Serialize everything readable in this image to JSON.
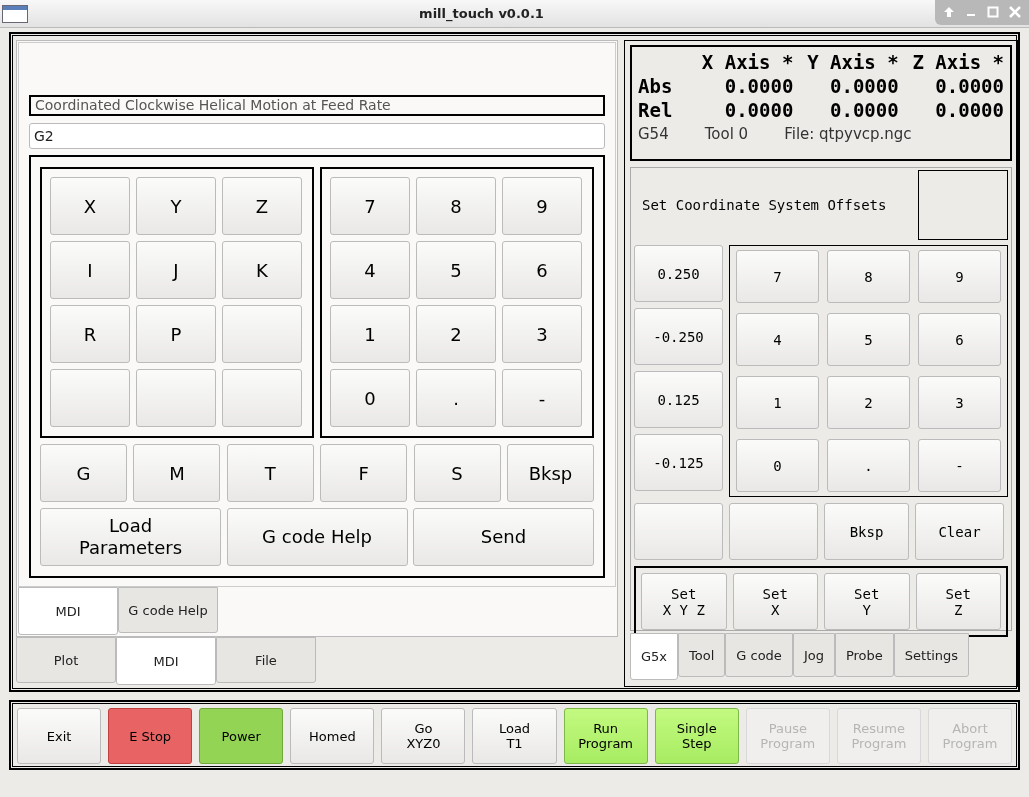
{
  "window": {
    "title": "mill_touch v0.0.1"
  },
  "mdi": {
    "description": "Coordinated Clockwise Helical Motion at Feed Rate",
    "command": "G2",
    "letter_keys": [
      {
        "kind": "key",
        "label": "X"
      },
      {
        "kind": "key",
        "label": "Y"
      },
      {
        "kind": "key",
        "label": "Z"
      },
      {
        "kind": "key",
        "label": "I"
      },
      {
        "kind": "key",
        "label": "J"
      },
      {
        "kind": "key",
        "label": "K"
      },
      {
        "kind": "key",
        "label": "R"
      },
      {
        "kind": "key",
        "label": "P"
      },
      {
        "kind": "blank"
      },
      {
        "kind": "blank"
      },
      {
        "kind": "blank"
      },
      {
        "kind": "blank"
      }
    ],
    "number_keys": [
      "7",
      "8",
      "9",
      "4",
      "5",
      "6",
      "1",
      "2",
      "3",
      "0",
      ".",
      "-"
    ],
    "command_keys": [
      "G",
      "M",
      "T",
      "F",
      "S",
      "Bksp"
    ],
    "action_buttons": [
      [
        "Load",
        "Parameters"
      ],
      [
        "G code Help"
      ],
      [
        "Send"
      ]
    ],
    "sub_tabs": [
      {
        "label": "MDI",
        "selected": true
      },
      {
        "label": "G code Help",
        "selected": false
      }
    ]
  },
  "main_tabs": [
    {
      "label": "Plot",
      "selected": false
    },
    {
      "label": "MDI",
      "selected": true
    },
    {
      "label": "File",
      "selected": false
    }
  ],
  "dro": {
    "headers": [
      "X Axis *",
      "Y Axis *",
      "Z Axis *"
    ],
    "rows": [
      {
        "label": "Abs",
        "values": [
          "0.0000",
          "0.0000",
          "0.0000"
        ]
      },
      {
        "label": "Rel",
        "values": [
          "0.0000",
          "0.0000",
          "0.0000"
        ]
      }
    ],
    "status": [
      "G54",
      "Tool 0",
      "File: qtpyvcp.ngc"
    ]
  },
  "offsets": {
    "title": "Set Coordinate System Offsets",
    "presets": [
      "0.250",
      "-0.250",
      "0.125",
      "-0.125"
    ],
    "keypad": [
      "7",
      "8",
      "9",
      "4",
      "5",
      "6",
      "1",
      "2",
      "3",
      "0",
      ".",
      "-"
    ],
    "edit_buttons": [
      {
        "kind": "blank"
      },
      {
        "kind": "blank"
      },
      {
        "kind": "key",
        "label": "Bksp"
      },
      {
        "kind": "key",
        "label": "Clear"
      }
    ],
    "set_buttons": [
      [
        "Set",
        "X Y Z"
      ],
      [
        "Set",
        "X"
      ],
      [
        "Set",
        "Y"
      ],
      [
        "Set",
        "Z"
      ]
    ]
  },
  "right_tabs": [
    {
      "label": "G5x",
      "selected": true
    },
    {
      "label": "Tool",
      "selected": false
    },
    {
      "label": "G code",
      "selected": false
    },
    {
      "label": "Jog",
      "selected": false
    },
    {
      "label": "Probe",
      "selected": false
    },
    {
      "label": "Settings",
      "selected": false
    }
  ],
  "bottom_buttons": [
    {
      "lines": [
        "Exit"
      ],
      "kind": "normal",
      "disabled": false
    },
    {
      "lines": [
        "E Stop"
      ],
      "kind": "estop",
      "disabled": false
    },
    {
      "lines": [
        "Power"
      ],
      "kind": "power",
      "disabled": false
    },
    {
      "lines": [
        "Homed"
      ],
      "kind": "normal",
      "disabled": false
    },
    {
      "lines": [
        "Go",
        "XYZ0"
      ],
      "kind": "normal",
      "disabled": false
    },
    {
      "lines": [
        "Load",
        "T1"
      ],
      "kind": "normal",
      "disabled": false
    },
    {
      "lines": [
        "Run",
        "Program"
      ],
      "kind": "ready",
      "disabled": false
    },
    {
      "lines": [
        "Single",
        "Step"
      ],
      "kind": "ready",
      "disabled": false
    },
    {
      "lines": [
        "Pause",
        "Program"
      ],
      "kind": "normal",
      "disabled": true
    },
    {
      "lines": [
        "Resume",
        "Program"
      ],
      "kind": "normal",
      "disabled": true
    },
    {
      "lines": [
        "Abort",
        "Program"
      ],
      "kind": "normal",
      "disabled": true
    }
  ]
}
